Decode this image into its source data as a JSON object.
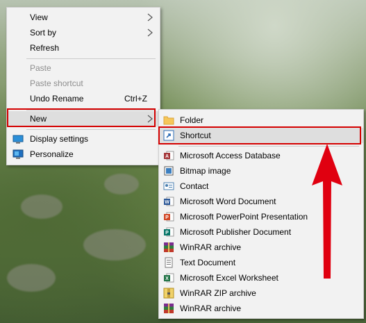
{
  "context_menu": {
    "items": [
      {
        "label": "View",
        "submenu": true
      },
      {
        "label": "Sort by",
        "submenu": true
      },
      {
        "label": "Refresh"
      },
      {
        "label": "Paste",
        "disabled": true
      },
      {
        "label": "Paste shortcut",
        "disabled": true
      },
      {
        "label": "Undo Rename",
        "shortcut": "Ctrl+Z"
      },
      {
        "label": "New",
        "submenu": true
      },
      {
        "label": "Display settings",
        "icon": "display-icon"
      },
      {
        "label": "Personalize",
        "icon": "personalize-icon"
      }
    ]
  },
  "new_submenu": {
    "items": [
      {
        "label": "Folder",
        "icon": "folder-icon"
      },
      {
        "label": "Shortcut",
        "icon": "shortcut-icon"
      },
      {
        "label": "Microsoft Access Database",
        "icon": "access-icon"
      },
      {
        "label": "Bitmap image",
        "icon": "bitmap-icon"
      },
      {
        "label": "Contact",
        "icon": "contact-icon"
      },
      {
        "label": "Microsoft Word Document",
        "icon": "word-icon"
      },
      {
        "label": "Microsoft PowerPoint Presentation",
        "icon": "powerpoint-icon"
      },
      {
        "label": "Microsoft Publisher Document",
        "icon": "publisher-icon"
      },
      {
        "label": "WinRAR archive",
        "icon": "winrar-icon"
      },
      {
        "label": "Text Document",
        "icon": "text-document-icon"
      },
      {
        "label": "Microsoft Excel Worksheet",
        "icon": "excel-icon"
      },
      {
        "label": "WinRAR ZIP archive",
        "icon": "winrar-zip-icon"
      },
      {
        "label": "WinRAR archive",
        "icon": "winrar-icon"
      }
    ]
  },
  "colors": {
    "highlight_box": "#d40000",
    "arrow": "#e00010"
  }
}
